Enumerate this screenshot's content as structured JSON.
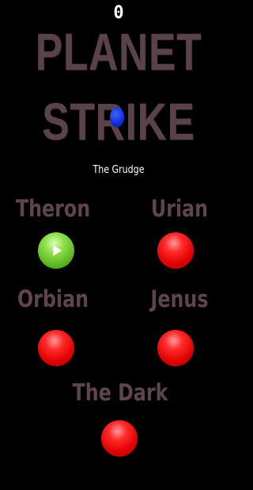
{
  "hud": {
    "score": "0"
  },
  "title": {
    "line1": "PLANET",
    "line2": "STRIKE",
    "subtitle": "The Grudge"
  },
  "levels": [
    {
      "label": "Theron",
      "state": "unlocked",
      "icon": "play-icon",
      "color": "#5cb521"
    },
    {
      "label": "Urian",
      "state": "locked",
      "color": "#dd0000"
    },
    {
      "label": "Orbian",
      "state": "locked",
      "color": "#dd0000"
    },
    {
      "label": "Jenus",
      "state": "locked",
      "color": "#dd0000"
    },
    {
      "label": "The Dark",
      "state": "locked",
      "color": "#dd0000"
    }
  ]
}
